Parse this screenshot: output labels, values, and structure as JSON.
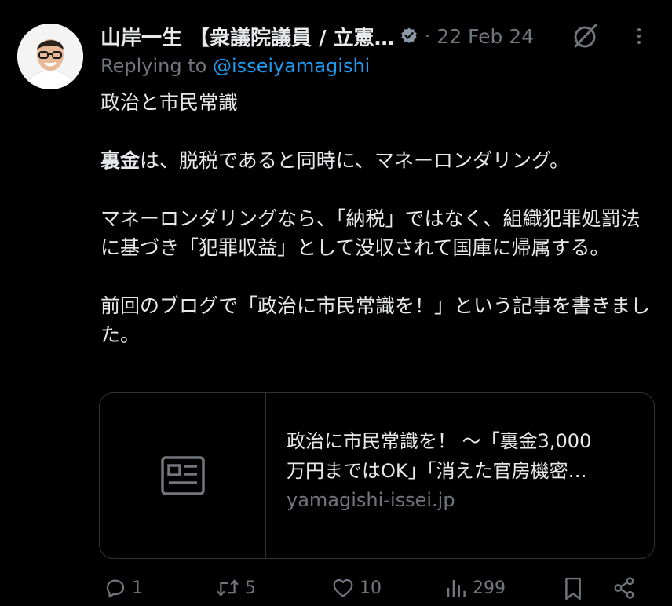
{
  "tweet": {
    "author_name": "山岸一生 【衆議院議員 / 立憲…",
    "separator": "·",
    "date": "22 Feb 24",
    "replying_prefix": "Replying to ",
    "replying_handle": "@isseiyamagishi",
    "body": {
      "line1": "政治と市民常識",
      "p2_bold": "裏金",
      "p2_rest": "は、脱税であると同時に、マネーロンダリング。",
      "p3": "マネーロンダリングなら、「納税」ではなく、組織犯罪処罰法に基づき「犯罪収益」として没収されて国庫に帰属する。",
      "p4": "前回のブログで「政治に市民常識を！」という記事を書きました。"
    }
  },
  "link_card": {
    "title_line1": "政治に市民常識を！ ～「裏金3,000",
    "title_line2": "万円まではOK」「消えた官房機密…",
    "domain": "yamagishi-issei.jp"
  },
  "actions": {
    "replies": "1",
    "reposts": "5",
    "likes": "10",
    "views": "299"
  },
  "colors": {
    "background": "#000000",
    "text": "#e7e9ea",
    "muted": "#71767b",
    "link": "#1d9bf0",
    "border": "#2f3336"
  },
  "icons": [
    "avatar",
    "verified-badge-icon",
    "grok-icon",
    "more-icon",
    "article-icon",
    "reply-icon",
    "repost-icon",
    "like-icon",
    "views-icon",
    "bookmark-icon",
    "share-icon"
  ]
}
